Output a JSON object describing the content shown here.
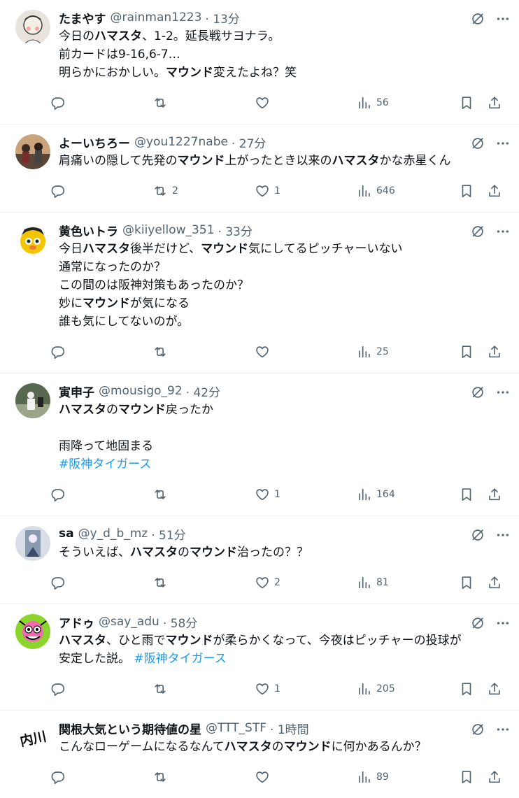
{
  "tweets": [
    {
      "name": "たまやす",
      "handle": "@rainman1223",
      "time": "· 13分",
      "lines": [
        [
          {
            "t": "今日の"
          },
          {
            "t": "ハマスタ",
            "b": true
          },
          {
            "t": "、1-2。延長戦サヨナラ。"
          }
        ],
        [
          {
            "t": "前カードは9-16,6-7…"
          }
        ],
        [
          {
            "t": "明らかにおかしい。"
          },
          {
            "t": "マウンド",
            "b": true
          },
          {
            "t": "変えたよね？笑"
          }
        ]
      ],
      "replies": "",
      "retweets": "",
      "likes": "",
      "views": "56",
      "avatar_color": "#e8e4dc"
    },
    {
      "name": "よーいちろー",
      "handle": "@you1227nabe",
      "time": "· 27分",
      "lines": [
        [
          {
            "t": "肩痛いの隠して先発の"
          },
          {
            "t": "マウンド",
            "b": true
          },
          {
            "t": "上がったとき以来の"
          },
          {
            "t": "ハマスタ",
            "b": true
          },
          {
            "t": "かな赤星くん"
          }
        ]
      ],
      "replies": "",
      "retweets": "2",
      "likes": "1",
      "views": "646",
      "avatar_color": "#6b5a4a"
    },
    {
      "name": "黄色いトラ",
      "handle": "@kiiyellow_351",
      "time": "· 33分",
      "lines": [
        [
          {
            "t": "今日"
          },
          {
            "t": "ハマスタ",
            "b": true
          },
          {
            "t": "後半だけど、"
          },
          {
            "t": "マウンド",
            "b": true
          },
          {
            "t": "気にしてるピッチャーいない"
          }
        ],
        [
          {
            "t": "通常になったのか？"
          }
        ],
        [
          {
            "t": "この間のは阪神対策もあったのか？"
          }
        ],
        [
          {
            "t": "妙に"
          },
          {
            "t": "マウンド",
            "b": true
          },
          {
            "t": "が気になる"
          }
        ],
        [
          {
            "t": "誰も気にしてないのが。"
          }
        ]
      ],
      "replies": "",
      "retweets": "",
      "likes": "",
      "views": "25",
      "avatar_color": "#f5c400"
    },
    {
      "name": "寅申子",
      "handle": "@mousigo_92",
      "time": "· 42分",
      "lines": [
        [
          {
            "t": "ハマスタ",
            "b": true
          },
          {
            "t": "の"
          },
          {
            "t": "マウンド",
            "b": true
          },
          {
            "t": "戻ったか"
          }
        ],
        [],
        [
          {
            "t": "雨降って地固まる"
          }
        ],
        [
          {
            "t": "#阪神タイガース",
            "tag": true
          }
        ]
      ],
      "replies": "",
      "retweets": "",
      "likes": "1",
      "views": "164",
      "avatar_color": "#4a5a48"
    },
    {
      "name": "sa",
      "handle": "@y_d_b_mz",
      "time": "· 51分",
      "lines": [
        [
          {
            "t": "そういえば、"
          },
          {
            "t": "ハマスタ",
            "b": true
          },
          {
            "t": "の"
          },
          {
            "t": "マウンド",
            "b": true
          },
          {
            "t": "治ったの？？"
          }
        ]
      ],
      "replies": "",
      "retweets": "",
      "likes": "2",
      "views": "81",
      "avatar_color": "#8a9ab0"
    },
    {
      "name": "アドゥ",
      "handle": "@say_adu",
      "time": "· 58分",
      "lines": [
        [
          {
            "t": "ハマスタ",
            "b": true
          },
          {
            "t": "、ひと雨で"
          },
          {
            "t": "マウンド",
            "b": true
          },
          {
            "t": "が柔らかくなって、今夜はピッチャーの投球が"
          }
        ],
        [
          {
            "t": "安定した説。 "
          },
          {
            "t": "#阪神タイガース",
            "tag": true
          }
        ]
      ],
      "replies": "",
      "retweets": "",
      "likes": "1",
      "views": "205",
      "avatar_color": "#8bd42c"
    },
    {
      "name": "関根大気という期待値の星",
      "handle": "@TTT_STF",
      "time": "· 1時間",
      "lines": [
        [
          {
            "t": "こんなローゲームになるなんて"
          },
          {
            "t": "ハマスタ",
            "b": true
          },
          {
            "t": "の"
          },
          {
            "t": "マウンド",
            "b": true
          },
          {
            "t": "に何かあるんか？"
          }
        ]
      ],
      "replies": "",
      "retweets": "",
      "likes": "",
      "views": "89",
      "avatar_color": "#ffffff",
      "avatar_text": "内川"
    }
  ]
}
